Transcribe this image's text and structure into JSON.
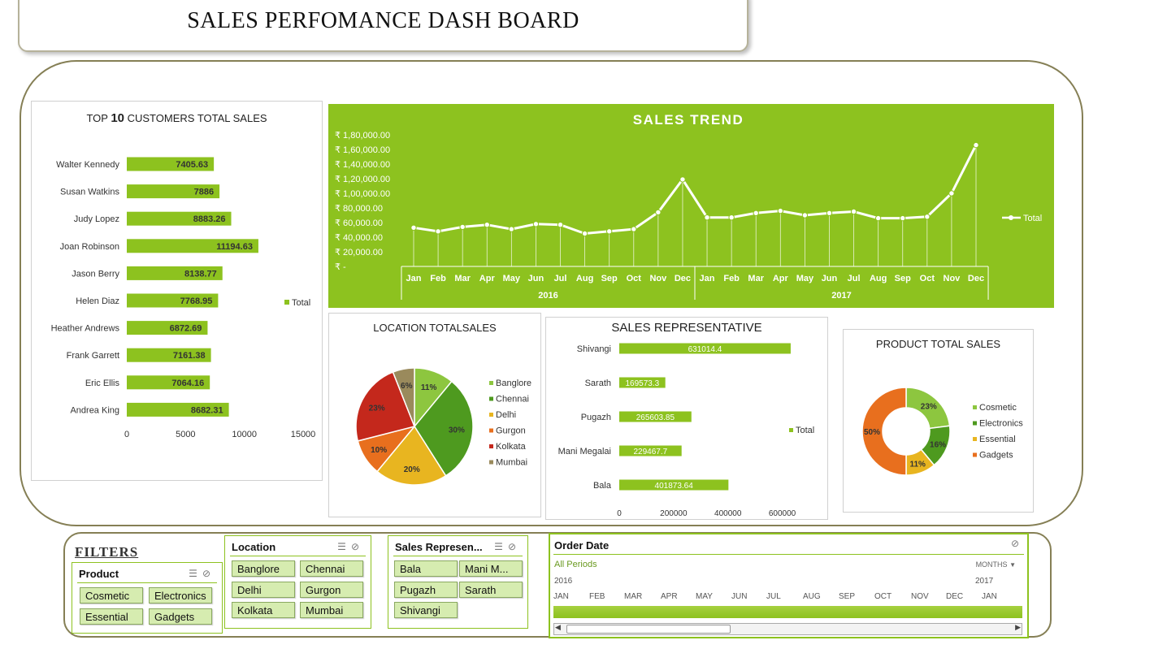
{
  "title": "SALES PERFOMANCE DASH BOARD",
  "top_customers": {
    "title_pre": "TOP ",
    "title_num": "10",
    "title_post": " CUSTOMERS TOTAL SALES",
    "legend": "Total",
    "x_ticks": [
      "0",
      "5000",
      "10000",
      "15000"
    ],
    "chart_data": {
      "type": "bar",
      "categories": [
        "Walter Kennedy",
        "Susan Watkins",
        "Judy Lopez",
        "Joan Robinson",
        "Jason Berry",
        "Helen Diaz",
        "Heather Andrews",
        "Frank Garrett",
        "Eric Ellis",
        "Andrea King"
      ],
      "values": [
        7405.63,
        7886,
        8883.26,
        11194.63,
        8138.77,
        7768.95,
        6872.69,
        7161.38,
        7064.16,
        8682.31
      ],
      "value_labels": [
        "7405.63",
        "7886",
        "8883.26",
        "11194.63",
        "8138.77",
        "7768.95",
        "6872.69",
        "7161.38",
        "7064.16",
        "8682.31"
      ],
      "xlim": [
        0,
        15000
      ],
      "legend_position": "right",
      "color": "#8dc21f"
    }
  },
  "sales_trend": {
    "title": "SALES TREND",
    "legend": "Total",
    "y_ticks": [
      "₹ 1,80,000.00",
      "₹ 1,60,000.00",
      "₹ 1,40,000.00",
      "₹ 1,20,000.00",
      "₹ 1,00,000.00",
      "₹ 80,000.00",
      "₹ 60,000.00",
      "₹ 40,000.00",
      "₹ 20,000.00",
      "₹ -"
    ],
    "months": [
      "Jan",
      "Feb",
      "Mar",
      "Apr",
      "May",
      "Jun",
      "Jul",
      "Aug",
      "Sep",
      "Oct",
      "Nov",
      "Dec"
    ],
    "years": [
      "2016",
      "2017"
    ],
    "chart_data": {
      "type": "line",
      "values": [
        53000,
        48000,
        54000,
        57000,
        51000,
        58000,
        57000,
        45000,
        48000,
        51000,
        74000,
        119000,
        67000,
        67000,
        73000,
        76000,
        70000,
        73000,
        75000,
        66000,
        66000,
        68000,
        100000,
        166000
      ],
      "ylim": [
        0,
        180000
      ],
      "background": "#8dc21f",
      "line_color": "#ffffff"
    }
  },
  "location_sales": {
    "title": "LOCATION TOTALSALES",
    "chart_data": {
      "type": "pie",
      "categories": [
        "Banglore",
        "Chennai",
        "Delhi",
        "Gurgon",
        "Kolkata",
        "Mumbai"
      ],
      "values": [
        11,
        30,
        20,
        10,
        23,
        6
      ],
      "labels": [
        "11%",
        "30%",
        "20%",
        "10%",
        "23%",
        "6%"
      ],
      "colors": [
        "#8dc63f",
        "#4e9a1f",
        "#e8b520",
        "#e86f1e",
        "#c4281c",
        "#9a8a5c"
      ],
      "legend_position": "right"
    }
  },
  "sales_rep": {
    "title": "SALES REPRESENTATIVE",
    "legend": "Total",
    "x_ticks": [
      "0",
      "200000",
      "400000",
      "600000"
    ],
    "chart_data": {
      "type": "bar",
      "categories": [
        "Shivangi",
        "Sarath",
        "Pugazh",
        "Mani Megalai",
        "Bala"
      ],
      "values": [
        631014.4,
        169573.3,
        265603.85,
        229467.7,
        401873.64
      ],
      "value_labels": [
        "631014.4",
        "169573.3",
        "265603.85",
        "229467.7",
        "401873.64"
      ],
      "xlim": [
        0,
        700000
      ],
      "color": "#8dc21f",
      "legend_position": "right"
    }
  },
  "product_sales": {
    "title": "PRODUCT TOTAL SALES",
    "chart_data": {
      "type": "pie",
      "categories": [
        "Cosmetic",
        "Electronics",
        "Essential",
        "Gadgets"
      ],
      "values": [
        23,
        16,
        11,
        50
      ],
      "labels": [
        "23%",
        "16%",
        "11%",
        "50%"
      ],
      "colors": [
        "#8dc63f",
        "#4e9a1f",
        "#e8b520",
        "#e86f1e"
      ],
      "legend_position": "right"
    }
  },
  "filters": {
    "label": "FILTERS",
    "product": {
      "header": "Product",
      "items": [
        "Cosmetic",
        "Electronics",
        "Essential",
        "Gadgets"
      ]
    },
    "location": {
      "header": "Location",
      "items": [
        "Banglore",
        "Chennai",
        "Delhi",
        "Gurgon",
        "Kolkata",
        "Mumbai"
      ]
    },
    "sales_rep": {
      "header": "Sales Represen...",
      "items": [
        "Bala",
        "Mani M...",
        "Pugazh",
        "Sarath",
        "Shivangi"
      ]
    },
    "order_date": {
      "header": "Order Date",
      "all_periods": "All Periods",
      "granularity": "MONTHS",
      "year_start": "2016",
      "year_next": "2017",
      "months": [
        "JAN",
        "FEB",
        "MAR",
        "APR",
        "MAY",
        "JUN",
        "JUL",
        "AUG",
        "SEP",
        "OCT",
        "NOV",
        "DEC",
        "JAN"
      ]
    }
  },
  "icons": {
    "multi_select": "multi-select-icon",
    "clear_filter": "clear-filter-icon"
  }
}
